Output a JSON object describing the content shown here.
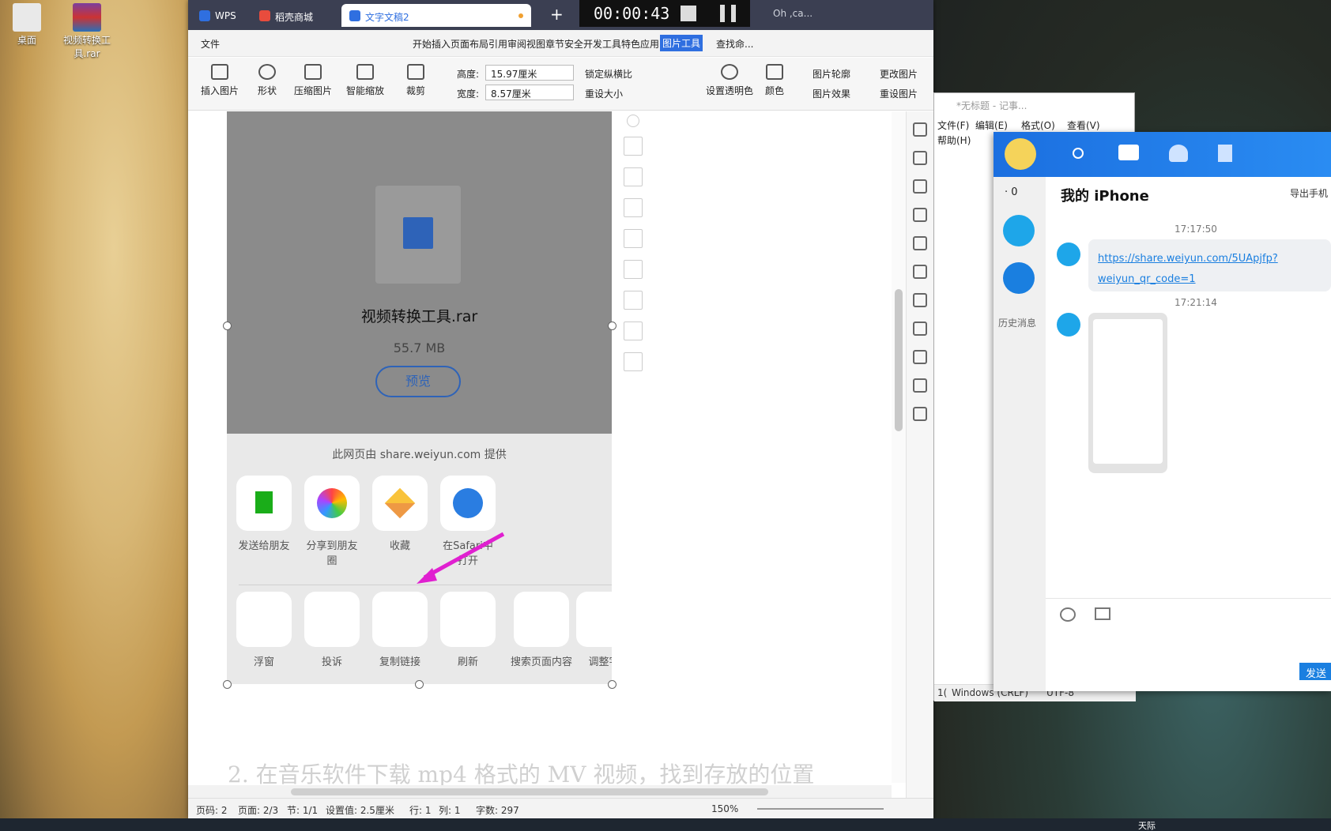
{
  "desktop": {
    "icons": [
      {
        "label": "桌面"
      },
      {
        "label": "视频转换工具.rar"
      }
    ]
  },
  "recorder": {
    "time": "00:00:43"
  },
  "wps": {
    "tabs": [
      {
        "label": "WPS"
      },
      {
        "label": "稻壳商城"
      },
      {
        "label": "文字文稿2"
      }
    ],
    "new_tab": "+",
    "account": "Oh ,ca...",
    "file_menu": "文件",
    "menu": [
      "开始",
      "插入",
      "页面布局",
      "引用",
      "审阅",
      "视图",
      "章节",
      "安全",
      "开发工具",
      "特色应用",
      "图片工具"
    ],
    "search": "查找命...",
    "ribbon": {
      "insert_pic": "插入图片",
      "shape": "形状",
      "compress": "压缩图片",
      "smart_zoom": "智能缩放",
      "crop": "裁剪",
      "height_label": "高度:",
      "height_value": "15.97厘米",
      "width_label": "宽度:",
      "width_value": "8.57厘米",
      "lock_ratio": "锁定纵横比",
      "reset_size": "重设大小",
      "transparent": "设置透明色",
      "color": "颜色",
      "pic_outline": "图片轮廓",
      "pic_effect": "图片效果",
      "change_pic": "更改图片",
      "reset_pic": "重设图片"
    },
    "doc_text": "2. 在音乐软件下载 mp4 格式的 MV 视频，找到存放的位置",
    "status": {
      "page_code": "页码: 2",
      "page": "页面: 2/3",
      "section": "节: 1/1",
      "setting": "设置值: 2.5厘米",
      "row": "行: 1",
      "col": "列: 1",
      "words": "字数: 297",
      "zoom": "150%"
    }
  },
  "phone": {
    "file_name": "视频转换工具.rar",
    "file_size": "55.7 MB",
    "preview": "预览",
    "provider": "此网页由 share.weiyun.com 提供",
    "apps": [
      {
        "label": "发送给朋友"
      },
      {
        "label": "分享到朋友圈"
      },
      {
        "label": "收藏"
      },
      {
        "label": "在Safari中打开"
      }
    ],
    "actions": [
      {
        "label": "浮窗"
      },
      {
        "label": "投诉"
      },
      {
        "label": "复制链接"
      },
      {
        "label": "刷新"
      },
      {
        "label": "搜索页面内容"
      },
      {
        "label": "调整字"
      }
    ]
  },
  "notepad": {
    "title": "*无标题 - 记事...",
    "menu": [
      "文件(F)",
      "编辑(E)",
      "格式(O)",
      "查看(V)",
      "帮助(H)"
    ],
    "status_pos": "1(",
    "status_eol": "Windows (CRLF)",
    "status_enc": "UTF-8"
  },
  "qq": {
    "badge": "· 0",
    "title": "我的 iPhone",
    "export": "导出手机",
    "history": "历史消息",
    "time1": "17:17:50",
    "link1": "https://share.weiyun.com/5UApjfp?",
    "link2": "weiyun_qr_code=1",
    "time2": "17:21:14",
    "send": "发送"
  },
  "taskbar": {
    "tray": "天际"
  }
}
